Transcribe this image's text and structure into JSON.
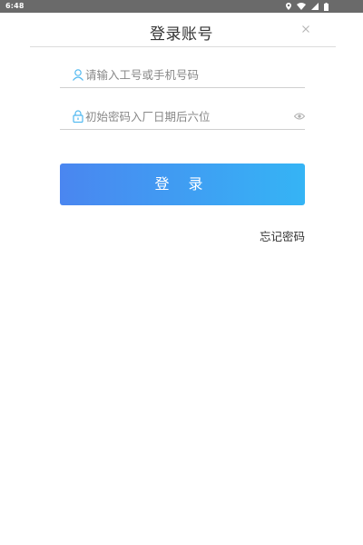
{
  "status_bar": {
    "time": "6:48"
  },
  "header": {
    "title": "登录账号",
    "close_symbol": "×"
  },
  "form": {
    "account_placeholder": "请输入工号或手机号码",
    "password_placeholder": "初始密码入厂日期后六位",
    "login_label": "登 录",
    "forgot_label": "忘记密码"
  },
  "icons": {
    "account": "user-icon",
    "password": "lock-icon",
    "visibility": "eye-icon",
    "close": "close-icon"
  },
  "colors": {
    "accent": "#4fb8f0",
    "button_gradient_start": "#4a86f0",
    "button_gradient_end": "#35b4f5",
    "text": "#333333",
    "placeholder": "#888888"
  }
}
